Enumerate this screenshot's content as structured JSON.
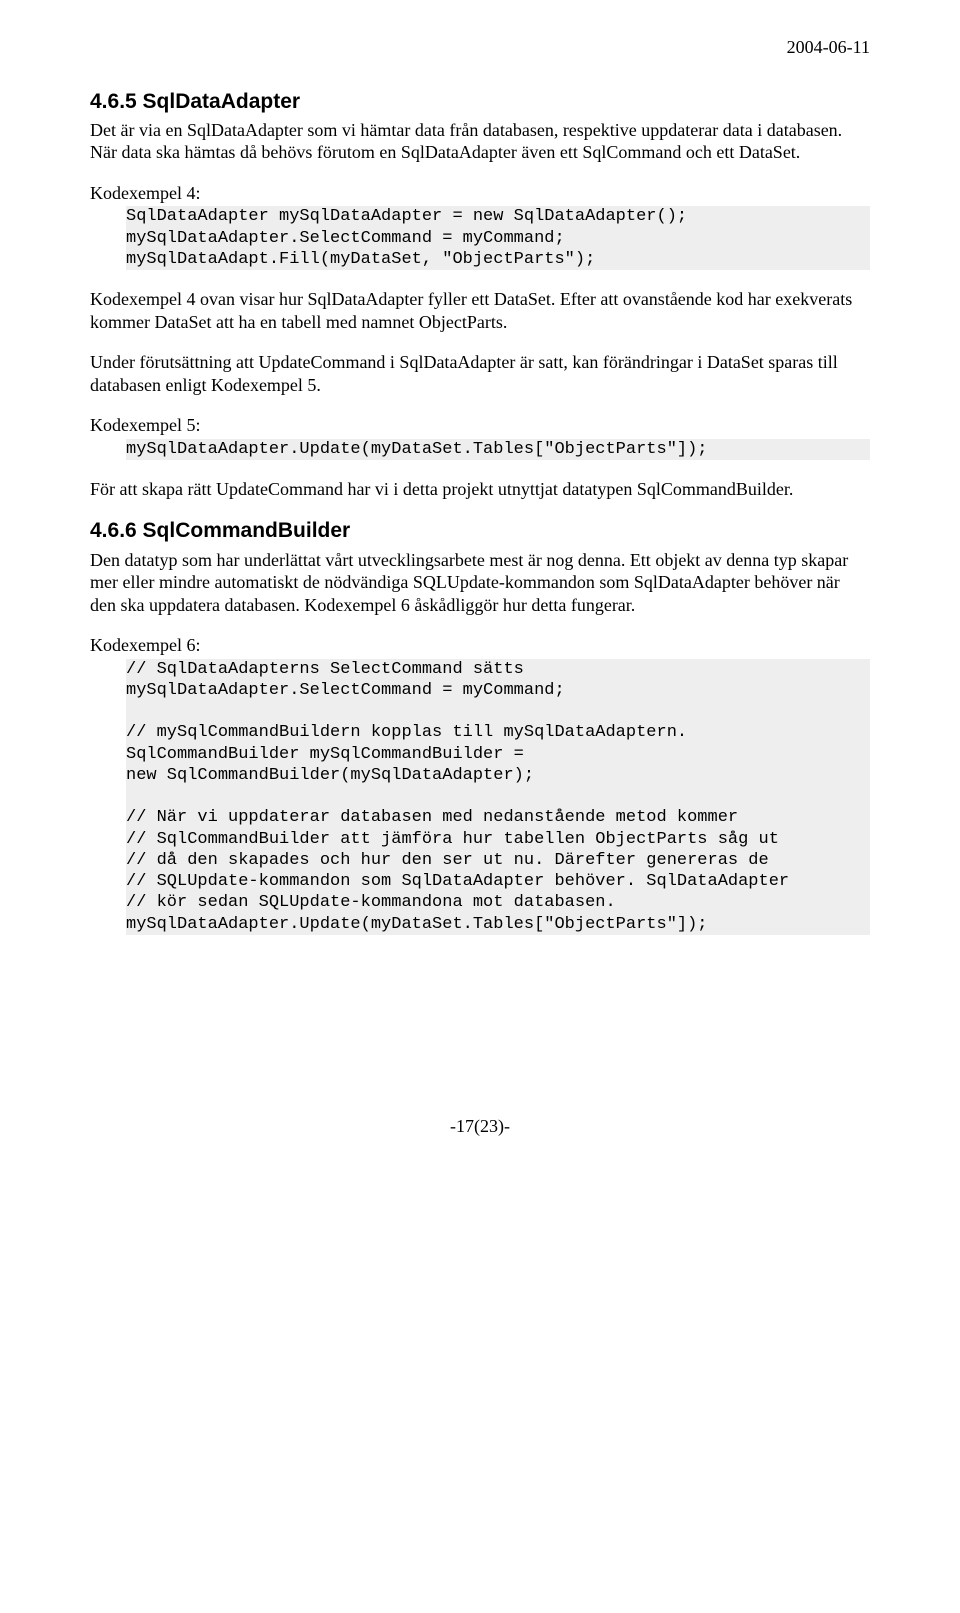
{
  "date": "2004-06-11",
  "h1": "4.6.5 SqlDataAdapter",
  "p1": "Det är via en SqlDataAdapter som vi hämtar data från databasen, respektive uppdaterar data i databasen. När data ska hämtas då behövs förutom en SqlDataAdapter även ett SqlCommand och ett DataSet.",
  "kod4label": "Kodexempel 4:",
  "kod4": "SqlDataAdapter mySqlDataAdapter = new SqlDataAdapter();\nmySqlDataAdapter.SelectCommand = myCommand;\nmySqlDataAdapt.Fill(myDataSet, \"ObjectParts\");",
  "p2": "Kodexempel 4 ovan visar hur SqlDataAdapter fyller ett DataSet. Efter att ovanstående kod har exekverats kommer DataSet att ha en tabell med namnet ObjectParts.",
  "p3": "Under förutsättning att UpdateCommand i SqlDataAdapter är satt, kan förändringar i DataSet sparas till databasen enligt Kodexempel 5.",
  "kod5label": "Kodexempel 5:",
  "kod5": "mySqlDataAdapter.Update(myDataSet.Tables[\"ObjectParts\"]);",
  "p4": "För att skapa rätt UpdateCommand har vi i detta projekt utnyttjat datatypen SqlCommandBuilder.",
  "h2": "4.6.6 SqlCommandBuilder",
  "p5": "Den datatyp som har underlättat vårt utvecklingsarbete mest är nog denna. Ett objekt av denna typ skapar mer eller mindre automatiskt de nödvändiga SQLUpdate-kommandon som SqlDataAdapter behöver när den ska uppdatera databasen. Kodexempel 6 åskådliggör hur detta fungerar.",
  "kod6label": "Kodexempel 6:",
  "kod6": "// SqlDataAdapterns SelectCommand sätts\nmySqlDataAdapter.SelectCommand = myCommand;\n\n// mySqlCommandBuildern kopplas till mySqlDataAdaptern.\nSqlCommandBuilder mySqlCommandBuilder =\nnew SqlCommandBuilder(mySqlDataAdapter);\n\n// När vi uppdaterar databasen med nedanstående metod kommer\n// SqlCommandBuilder att jämföra hur tabellen ObjectParts såg ut\n// då den skapades och hur den ser ut nu. Därefter genereras de\n// SQLUpdate-kommandon som SqlDataAdapter behöver. SqlDataAdapter\n// kör sedan SQLUpdate-kommandona mot databasen.\nmySqlDataAdapter.Update(myDataSet.Tables[\"ObjectParts\"]);",
  "footer": "-17(23)-"
}
